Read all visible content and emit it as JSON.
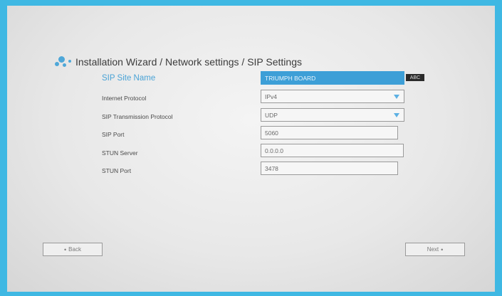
{
  "header": {
    "title": "Installation Wizard / Network settings / SIP Settings",
    "logo_icon": "brand-dots-icon"
  },
  "form": {
    "sip_site_name": {
      "label": "SIP Site Name",
      "value": "TRIUMPH BOARD",
      "input_mode_badge": "ABC"
    },
    "internet_protocol": {
      "label": "Internet Protocol",
      "value": "IPv4"
    },
    "sip_transmission_protocol": {
      "label": "SIP Transmission Protocol",
      "value": "UDP"
    },
    "sip_port": {
      "label": "SIP Port",
      "value": "5060"
    },
    "stun_server": {
      "label": "STUN Server",
      "value": "0.0.0.0"
    },
    "stun_port": {
      "label": "STUN Port",
      "value": "3478"
    }
  },
  "navigation": {
    "back_label": "Back",
    "next_label": "Next"
  },
  "colors": {
    "frame": "#3fb8e3",
    "accent": "#3d9fd7",
    "active_label": "#4aa3d6"
  }
}
